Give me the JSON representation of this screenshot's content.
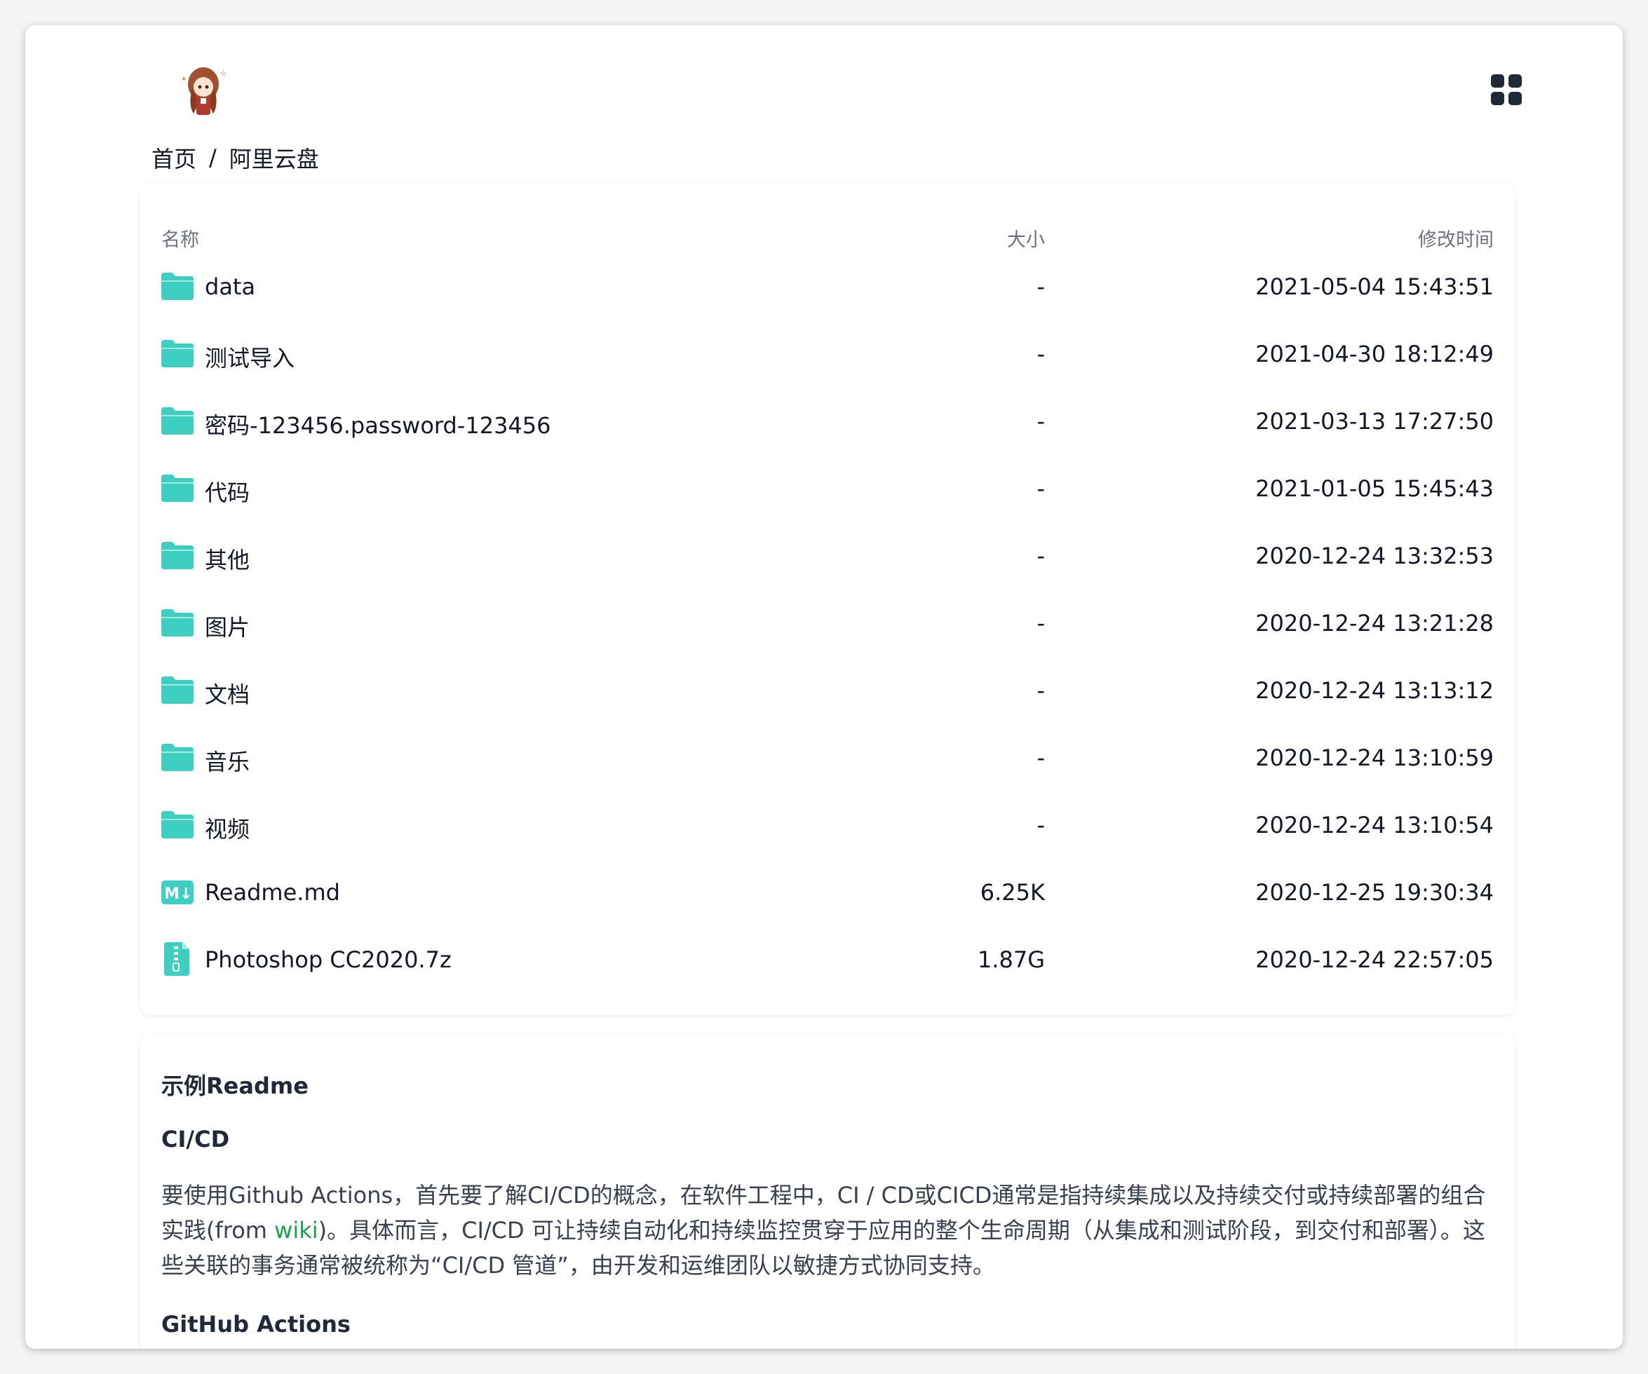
{
  "breadcrumb": {
    "home": "首页",
    "separator": "/",
    "current": "阿里云盘"
  },
  "table": {
    "headers": {
      "name": "名称",
      "size": "大小",
      "time": "修改时间"
    },
    "rows": [
      {
        "icon": "folder-icon",
        "name": "data",
        "size": "-",
        "time": "2021-05-04 15:43:51"
      },
      {
        "icon": "folder-icon",
        "name": "测试导入",
        "size": "-",
        "time": "2021-04-30 18:12:49"
      },
      {
        "icon": "folder-icon",
        "name": "密码-123456.password-123456",
        "size": "-",
        "time": "2021-03-13 17:27:50"
      },
      {
        "icon": "folder-icon",
        "name": "代码",
        "size": "-",
        "time": "2021-01-05 15:45:43"
      },
      {
        "icon": "folder-icon",
        "name": "其他",
        "size": "-",
        "time": "2020-12-24 13:32:53"
      },
      {
        "icon": "folder-icon",
        "name": "图片",
        "size": "-",
        "time": "2020-12-24 13:21:28"
      },
      {
        "icon": "folder-icon",
        "name": "文档",
        "size": "-",
        "time": "2020-12-24 13:13:12"
      },
      {
        "icon": "folder-icon",
        "name": "音乐",
        "size": "-",
        "time": "2020-12-24 13:10:59"
      },
      {
        "icon": "folder-icon",
        "name": "视频",
        "size": "-",
        "time": "2020-12-24 13:10:54"
      },
      {
        "icon": "markdown-icon",
        "name": "Readme.md",
        "size": "6.25K",
        "time": "2020-12-25 19:30:34"
      },
      {
        "icon": "zip-icon",
        "name": "Photoshop CC2020.7z",
        "size": "1.87G",
        "time": "2020-12-24 22:57:05"
      }
    ]
  },
  "readme": {
    "title": "示例Readme",
    "h_cicd": "CI/CD",
    "p1_before": "要使用Github Actions，首先要了解CI/CD的概念，在软件工程中，CI / CD或CICD通常是指持续集成以及持续交付或持续部署的组合实践(from ",
    "p1_link": "wiki",
    "p1_after": ")。具体而言，CI/CD 可让持续自动化和持续监控贯穿于应用的整个生命周期（从集成和测试阶段，到交付和部署）。这些关联的事务通常被统称为“CI/CD 管道”，由开发和运维团队以敏捷方式协同支持。",
    "h_actions": "GitHub Actions"
  },
  "colors": {
    "accent": "#3ecfc2",
    "link": "#16a34a",
    "text": "#111827",
    "muted": "#6b7280"
  }
}
